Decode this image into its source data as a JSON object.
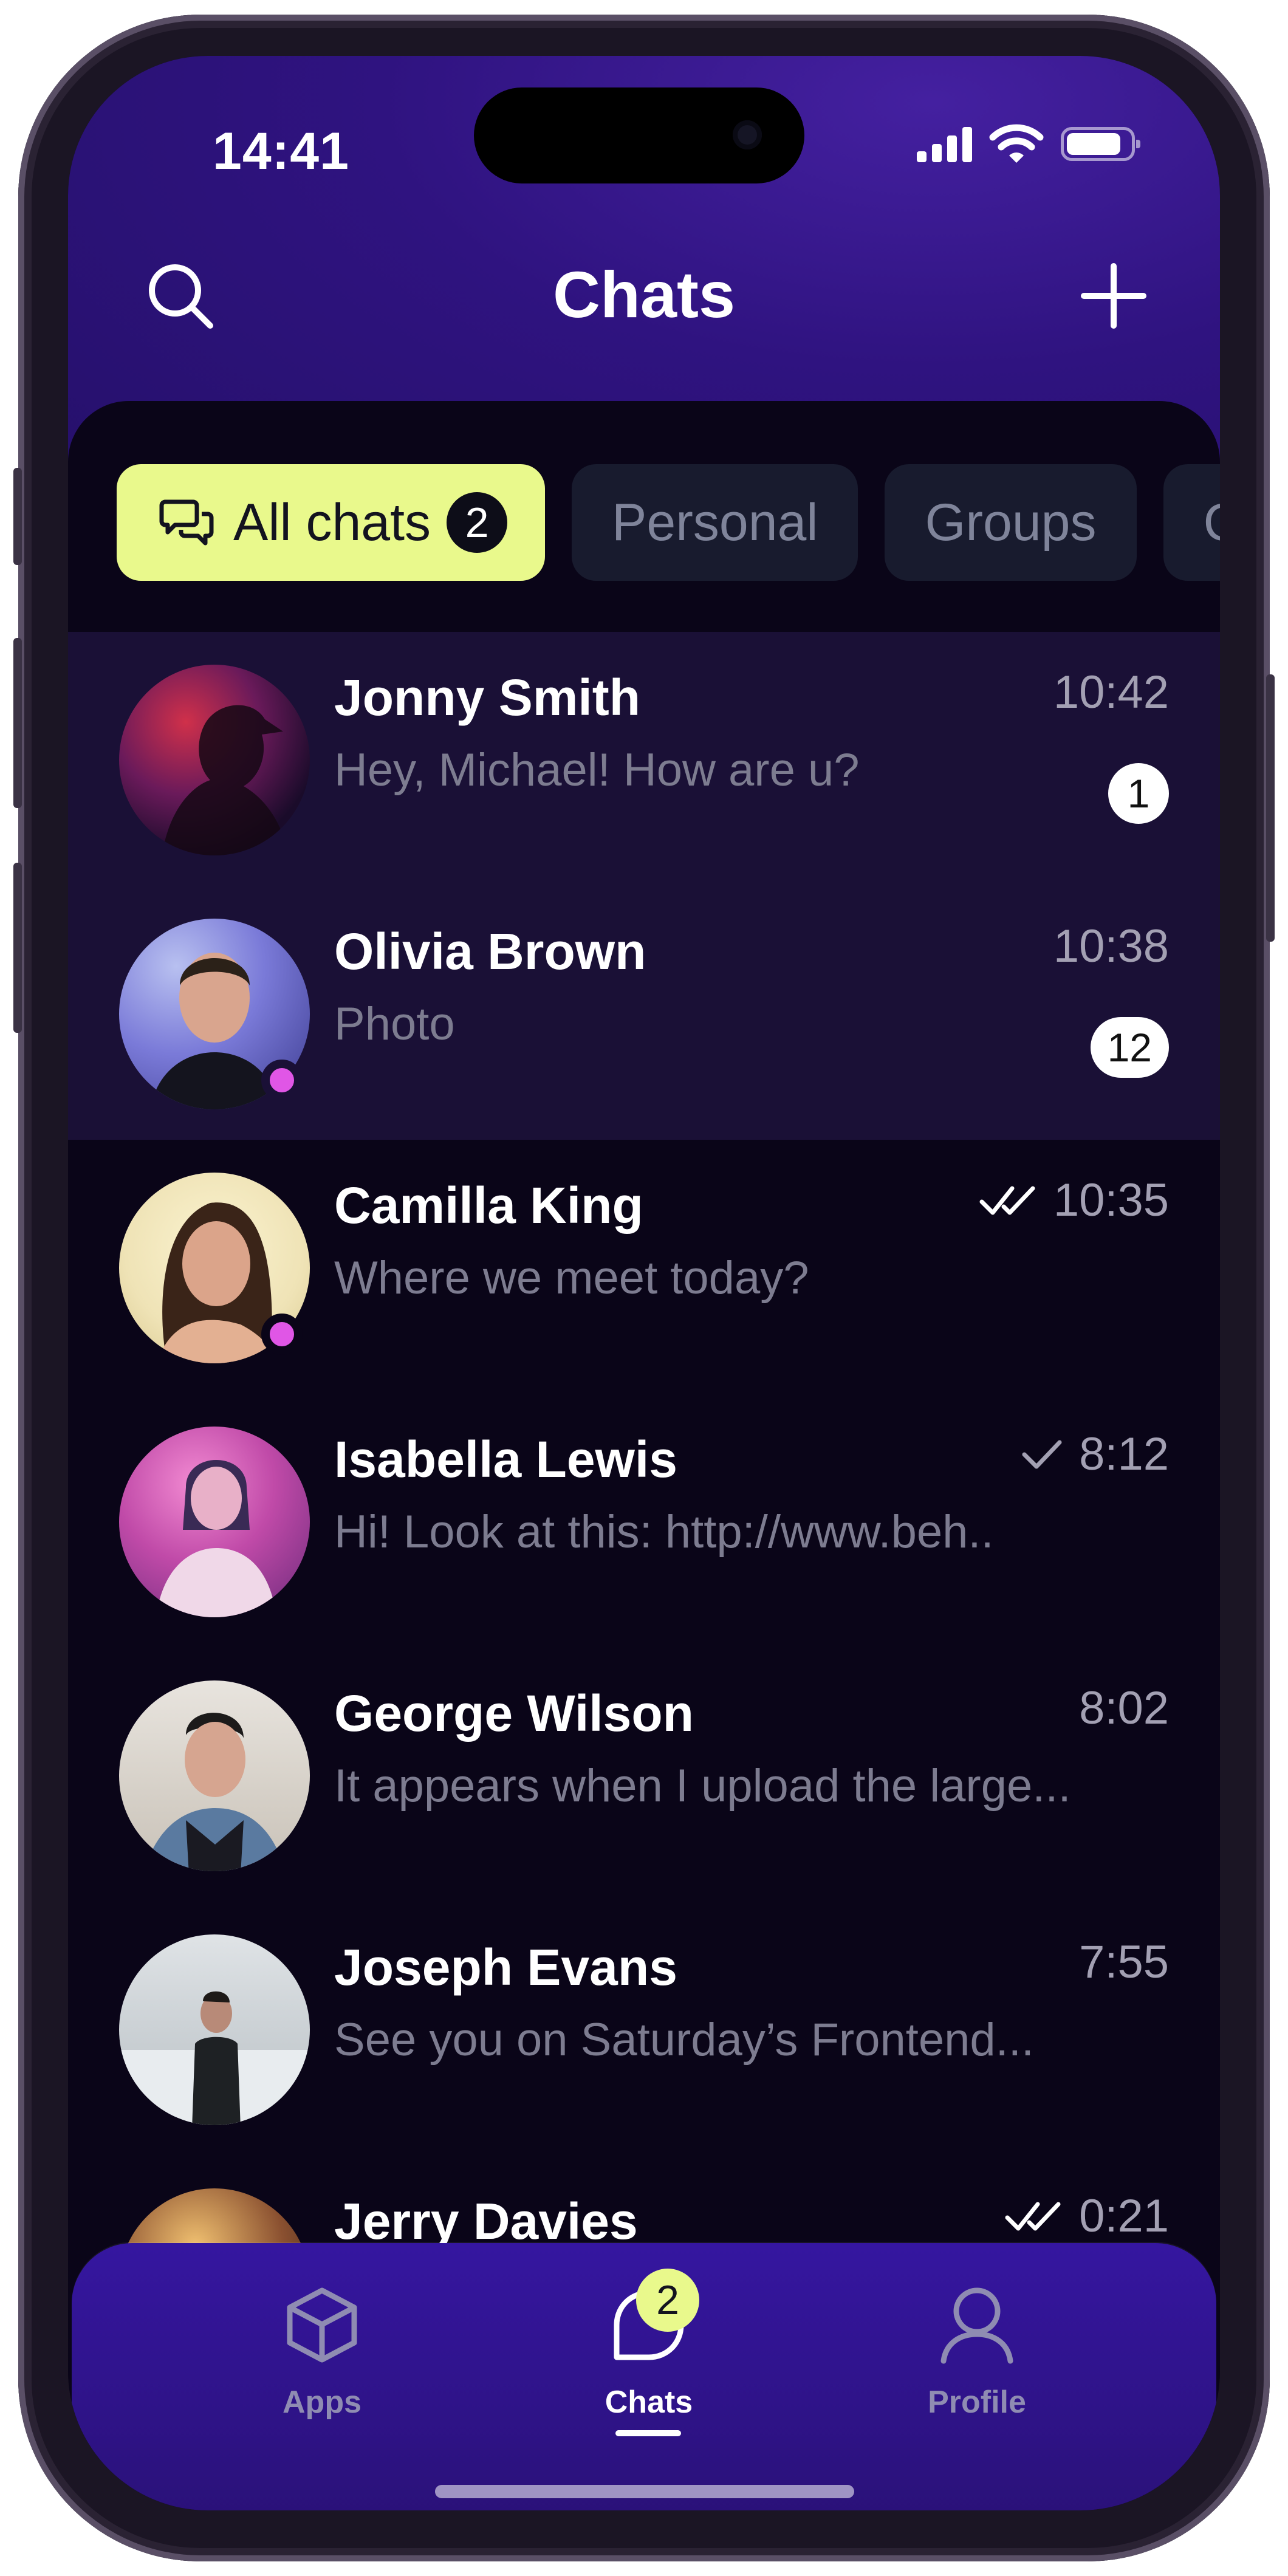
{
  "status_bar": {
    "time": "14:41"
  },
  "header": {
    "title": "Chats",
    "search_icon": "search-icon",
    "add_icon": "plus-icon"
  },
  "filters": [
    {
      "label": "All chats",
      "badge": "2",
      "active": true
    },
    {
      "label": "Personal"
    },
    {
      "label": "Groups"
    },
    {
      "label": "C"
    }
  ],
  "chats": [
    {
      "name": "Jonny Smith",
      "preview": "Hey, Michael! How are u?",
      "time": "10:42",
      "unread": "1",
      "highlighted": true
    },
    {
      "name": "Olivia Brown",
      "preview": "Photo",
      "time": "10:38",
      "unread": "12",
      "highlighted": true,
      "online": true
    },
    {
      "name": "Camilla King",
      "preview": "Where we meet today?",
      "time": "10:35",
      "status": "read",
      "online": true
    },
    {
      "name": "Isabella Lewis",
      "preview": "Hi! Look at this: http://www.beh..",
      "time": "8:12",
      "status": "sent"
    },
    {
      "name": "George Wilson",
      "preview": "It appears when I upload the large...",
      "time": "8:02"
    },
    {
      "name": "Joseph Evans",
      "preview": "See you on Saturday’s Frontend...",
      "time": "7:55"
    },
    {
      "name": "Jerry Davies",
      "preview": "",
      "time": "0:21",
      "status": "read"
    }
  ],
  "tabbar": {
    "tabs": [
      {
        "label": "Apps",
        "icon": "cube-icon"
      },
      {
        "label": "Chats",
        "icon": "chat-bubble-icon",
        "badge": "2",
        "active": true
      },
      {
        "label": "Profile",
        "icon": "person-icon"
      }
    ]
  },
  "colors": {
    "accent": "#e9f98c",
    "header": "#2f1380",
    "background": "#0a0518",
    "online": "#e056e6"
  }
}
